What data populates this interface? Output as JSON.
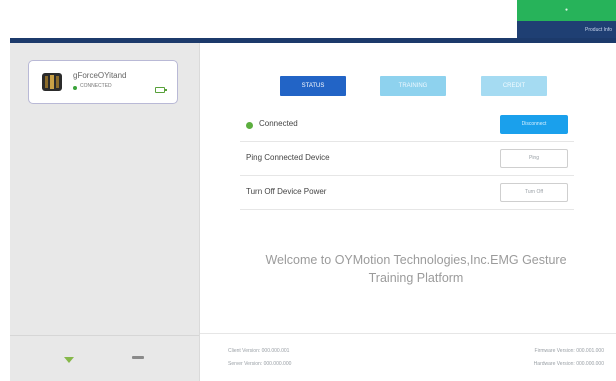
{
  "corner": {
    "label": "Product Info",
    "accent": "#27b35a"
  },
  "device": {
    "name": "gForceOYitand",
    "status": "CONNECTED",
    "icon": "armband-device-icon",
    "battery_icon": "battery-icon"
  },
  "sidebar": {
    "add_icon": "add-icon",
    "remove_icon": "remove-icon"
  },
  "tabs": [
    {
      "label": "STATUS",
      "active": true
    },
    {
      "label": "TRAINING",
      "active": false
    },
    {
      "label": "CREDIT",
      "active": false
    }
  ],
  "rows": {
    "connected": {
      "label": "Connected",
      "button": "Disconnect"
    },
    "ping": {
      "label": "Ping Connected Device",
      "button": "Ping"
    },
    "power_off": {
      "label": "Turn Off Device Power",
      "button": "Turn Off"
    }
  },
  "welcome": {
    "line1": "Welcome to OYMotion Technologies,Inc.EMG Gesture",
    "line2": "Training Platform"
  },
  "versions": {
    "client": "Client Version: 000.000.001",
    "server": "Server Version: 000.000.000",
    "firmware": "Firmware Version: 000.001.000",
    "hardware": "Hardware Version: 000.000.000"
  },
  "colors": {
    "title_bar": "#1c3a6b",
    "tab_active": "#2264c6",
    "tab_inactive": "#8ed2ee",
    "disconnect": "#1aa0ec",
    "connected_dot": "#5cae3f"
  }
}
